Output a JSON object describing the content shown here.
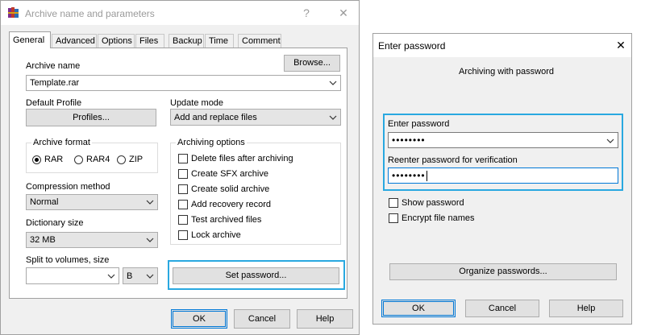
{
  "archive_dialog": {
    "title": "Archive name and parameters",
    "help_button": "?",
    "close_button": "✕",
    "tabs": [
      "General",
      "Advanced",
      "Options",
      "Files",
      "Backup",
      "Time",
      "Comment"
    ],
    "archive_name_label": "Archive name",
    "browse_label": "Browse...",
    "archive_name_value": "Template.rar",
    "default_profile_label": "Default Profile",
    "profiles_label": "Profiles...",
    "update_mode_label": "Update mode",
    "update_mode_value": "Add and replace files",
    "archive_format_label": "Archive format",
    "formats": [
      "RAR",
      "RAR4",
      "ZIP"
    ],
    "selected_format": "RAR",
    "archiving_options_label": "Archiving options",
    "options": [
      "Delete files after archiving",
      "Create SFX archive",
      "Create solid archive",
      "Add recovery record",
      "Test archived files",
      "Lock archive"
    ],
    "compression_method_label": "Compression method",
    "compression_method_value": "Normal",
    "dictionary_size_label": "Dictionary size",
    "dictionary_size_value": "32 MB",
    "split_label": "Split to volumes, size",
    "split_value": "",
    "split_unit": "B",
    "set_password_label": "Set password...",
    "ok_label": "OK",
    "cancel_label": "Cancel",
    "help_label": "Help"
  },
  "password_dialog": {
    "title": "Enter password",
    "close_button": "✕",
    "heading": "Archiving with password",
    "enter_password_label": "Enter password",
    "enter_password_value": "••••••••",
    "reenter_label": "Reenter password for verification",
    "reenter_value": "••••••••",
    "show_password_label": "Show password",
    "encrypt_names_label": "Encrypt file names",
    "organize_label": "Organize passwords...",
    "ok_label": "OK",
    "cancel_label": "Cancel",
    "help_label": "Help"
  },
  "colors": {
    "highlight": "#29a8e0",
    "focus_border": "#0078d7",
    "dialog_bg": "#f0f0f0"
  },
  "icons": {
    "app_icon": "winrar-books-icon",
    "dropdown": "chevron-down-icon"
  }
}
